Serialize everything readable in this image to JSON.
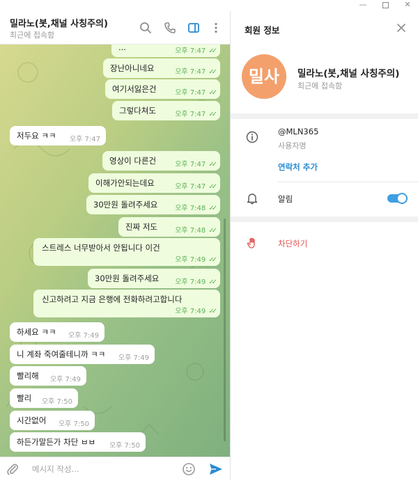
{
  "chat": {
    "title": "밀라노(봇,채널 사칭주의)",
    "status": "최근에 접속함",
    "messages": [
      {
        "dir": "out",
        "text": "...",
        "time": "오후 7:47"
      },
      {
        "dir": "out",
        "text": "장난아니네요",
        "time": "오후 7:47"
      },
      {
        "dir": "out",
        "text": "여기서잃은건",
        "time": "오후 7:47"
      },
      {
        "dir": "out",
        "text": "그렇다쳐도",
        "time": "오후 7:47"
      },
      {
        "dir": "in",
        "text": "저두요 ㅋㅋ",
        "time": "오후 7:47"
      },
      {
        "dir": "out",
        "text": "영상이 다른건",
        "time": "오후 7:47"
      },
      {
        "dir": "out",
        "text": "이해가안되는데요",
        "time": "오후 7:47"
      },
      {
        "dir": "out",
        "text": "30만원 돌려주세요",
        "time": "오후 7:48"
      },
      {
        "dir": "out",
        "text": "진짜 저도",
        "time": "오후 7:48"
      },
      {
        "dir": "out",
        "text": "스트레스 너무받아서 안됩니다 이건",
        "time": "오후 7:49"
      },
      {
        "dir": "out",
        "text": "30만원 돌려주세요",
        "time": "오후 7:49"
      },
      {
        "dir": "out",
        "text": "신고하려고 지금 은행에 전화하려고합니다",
        "time": "오후 7:49"
      },
      {
        "dir": "in",
        "text": "하세요 ㅋㅋ",
        "time": "오후 7:49"
      },
      {
        "dir": "in",
        "text": "니 계좌 죽여줄테니까 ㅋㅋ",
        "time": "오후 7:49"
      },
      {
        "dir": "in",
        "text": "빨리해",
        "time": "오후 7:49"
      },
      {
        "dir": "in",
        "text": "빨리",
        "time": "오후 7:50"
      },
      {
        "dir": "in",
        "text": "시간없어",
        "time": "오후 7:50"
      },
      {
        "dir": "in",
        "text": "하든가말든가 차단 ㅂㅂ",
        "time": "오후 7:50"
      }
    ],
    "composer_placeholder": "메시지 작성..."
  },
  "info": {
    "title": "회원 정보",
    "avatar_initials": "밀사",
    "name": "밀라노(봇,채널 사칭주의)",
    "status": "최근에 접속함",
    "username": "@MLN365",
    "username_label": "사용자명",
    "add_contact": "연락처 추가",
    "notifications_label": "알림",
    "notifications_on": true,
    "block_label": "차단하기"
  },
  "colors": {
    "outgoing_bubble": "#effdde",
    "incoming_bubble": "#ffffff",
    "accent_blue": "#2a8bd1",
    "danger_red": "#e0524f",
    "avatar_orange": "#f3a06c"
  },
  "icons": [
    "search-icon",
    "phone-icon",
    "sidebar-panel-icon",
    "more-vertical-icon",
    "paperclip-icon",
    "emoji-icon",
    "send-icon",
    "close-icon",
    "info-icon",
    "bell-icon",
    "hand-block-icon"
  ]
}
